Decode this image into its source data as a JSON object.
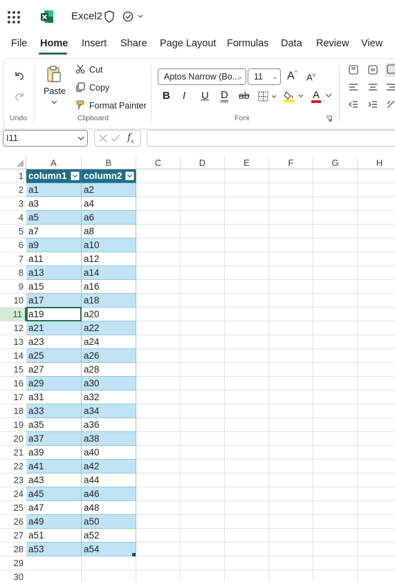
{
  "app": {
    "doc_title": "Excel2"
  },
  "tabs": [
    "File",
    "Home",
    "Insert",
    "Share",
    "Page Layout",
    "Formulas",
    "Data",
    "Review",
    "View"
  ],
  "ribbon": {
    "undo_group": "Undo",
    "paste": "Paste",
    "cut": "Cut",
    "copy": "Copy",
    "format_painter": "Format Painter",
    "clipboard_group": "Clipboard",
    "font_name": "Aptos Narrow (Bo...",
    "font_size": "11",
    "font_group": "Font",
    "bold": "B",
    "italic": "I",
    "underline": "U",
    "double_underline": "D",
    "strike": "ab",
    "grow": "A",
    "shrink": "A",
    "font_color": "A",
    "accent_green": "#217346",
    "font_color_swatch": "#e81123",
    "highlight_swatch": "#ffeb00"
  },
  "formula_bar": {
    "name_box": "I11",
    "formula": ""
  },
  "sheet": {
    "columns": [
      "A",
      "B",
      "C",
      "D",
      "E",
      "F",
      "G",
      "H"
    ],
    "rows": [
      "1",
      "2",
      "3",
      "4",
      "5",
      "6",
      "7",
      "8",
      "9",
      "10",
      "11",
      "12",
      "13",
      "14",
      "15",
      "16",
      "17",
      "18",
      "19",
      "20",
      "21",
      "22",
      "23",
      "24",
      "25",
      "26",
      "27",
      "28",
      "29",
      "30"
    ],
    "selected_row": "11",
    "table_headers": [
      "column1",
      "column2"
    ],
    "table_rows": [
      [
        "a1",
        "a2"
      ],
      [
        "a3",
        "a4"
      ],
      [
        "a5",
        "a6"
      ],
      [
        "a7",
        "a8"
      ],
      [
        "a9",
        "a10"
      ],
      [
        "a11",
        "a12"
      ],
      [
        "a13",
        "a14"
      ],
      [
        "a15",
        "a16"
      ],
      [
        "a17",
        "a18"
      ],
      [
        "a19",
        "a20"
      ],
      [
        "a21",
        "a22"
      ],
      [
        "a23",
        "a24"
      ],
      [
        "a25",
        "a26"
      ],
      [
        "a27",
        "a28"
      ],
      [
        "a29",
        "a30"
      ],
      [
        "a31",
        "a32"
      ],
      [
        "a33",
        "a34"
      ],
      [
        "a35",
        "a36"
      ],
      [
        "a37",
        "a38"
      ],
      [
        "a39",
        "a40"
      ],
      [
        "a41",
        "a42"
      ],
      [
        "a43",
        "a44"
      ],
      [
        "a45",
        "a46"
      ],
      [
        "a47",
        "a48"
      ],
      [
        "a49",
        "a50"
      ],
      [
        "a51",
        "a52"
      ],
      [
        "a53",
        "a54"
      ]
    ]
  }
}
